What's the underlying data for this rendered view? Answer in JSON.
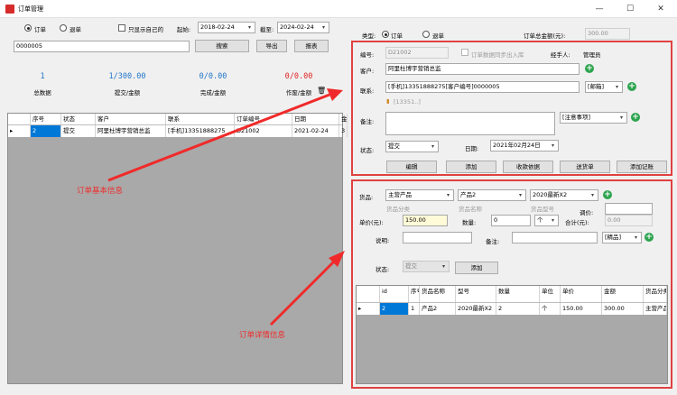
{
  "window": {
    "title": "订单管理",
    "minimize": "—",
    "maximize": "☐",
    "close": "✕"
  },
  "left": {
    "radio_order": "订单",
    "radio_return": "退单",
    "only_mine": "只显示自己的",
    "start_label": "起始:",
    "start_date": "2018-02-24",
    "end_label": "截至:",
    "end_date": "2024-02-24",
    "search_value": "0000005",
    "search_btn": "搜索",
    "export_btn": "导出",
    "report_btn": "报表",
    "stats": [
      {
        "value": "1",
        "label": "总数据",
        "color": "#1f74c9"
      },
      {
        "value": "1/300.00",
        "label": "提交/金额",
        "color": "#1f74c9"
      },
      {
        "value": "0/0.00",
        "label": "完成/金额",
        "color": "#1f74c9"
      },
      {
        "value": "0/0.00",
        "label": "作废/金额",
        "color": "#e02020"
      }
    ],
    "trash_icon": "🗑",
    "grid": {
      "headers": [
        "",
        "序号",
        "状态",
        "客户",
        "联系",
        "订单编号",
        "日期",
        "金"
      ],
      "rows": [
        [
          "▸",
          "2",
          "提交",
          "阿里杜博宇营销总监",
          "[手机]13351888275",
          "D21002",
          "2021-02-24",
          "3"
        ]
      ]
    },
    "annotation": "订单基本信息"
  },
  "order": {
    "type_label": "类型:",
    "radio_order": "订单",
    "radio_return": "退单",
    "total_label": "订单总金额(元):",
    "total_value": "300.00",
    "code_label": "编号:",
    "code_value": "D21002",
    "sync_label": "订单数据同步出入库",
    "handler_label": "经手人:",
    "handler_value": "管理员",
    "customer_label": "客户:",
    "customer_value": "阿里杜博宇营销总监",
    "contact_label": "联系:",
    "contact_value": "[手机]13351888275[客户编号]0000005",
    "contact_type": "[邮箱]",
    "phone_hint": "[13351..]",
    "note_label": "备注:",
    "note_type": "[注意事项]",
    "status_label": "状态:",
    "status_value": "提交",
    "date_label": "日期:",
    "date_value": "2021年02月24日",
    "buttons": [
      "编辑",
      "添加",
      "收款依据",
      "送货单",
      "添加记账"
    ]
  },
  "detail": {
    "product_label": "货品:",
    "product_category": "主营产品",
    "product_name": "产品2",
    "product_model": "2020最新X2",
    "hint_category": "货品分类",
    "hint_name": "货品名称",
    "hint_model": "货品型号",
    "adjust_label": "调价:",
    "price_label": "单价(元):",
    "price_value": "150.00",
    "qty_label": "数量:",
    "qty_value": "0",
    "unit_value": "个",
    "sum_label": "合计(元):",
    "sum_value": "0.00",
    "remark_label": "说明:",
    "note_label": "备注:",
    "quality_value": "[精品]",
    "status_label": "状态:",
    "status_value": "提交",
    "add_btn": "添加",
    "grid": {
      "headers": [
        "",
        "id",
        "序号",
        "货品名称",
        "型号",
        "数量",
        "单位",
        "单价",
        "金额",
        "货品分类"
      ],
      "rows": [
        [
          "▸",
          "2",
          "1",
          "产品2",
          "2020最新X2",
          "2",
          "个",
          "150.00",
          "300.00",
          "主营产品"
        ]
      ]
    },
    "annotation": "订单详情信息"
  },
  "colors": {
    "accent": "#0078d7",
    "annotation": "#f02a2a",
    "plus": "#2ea44f"
  }
}
